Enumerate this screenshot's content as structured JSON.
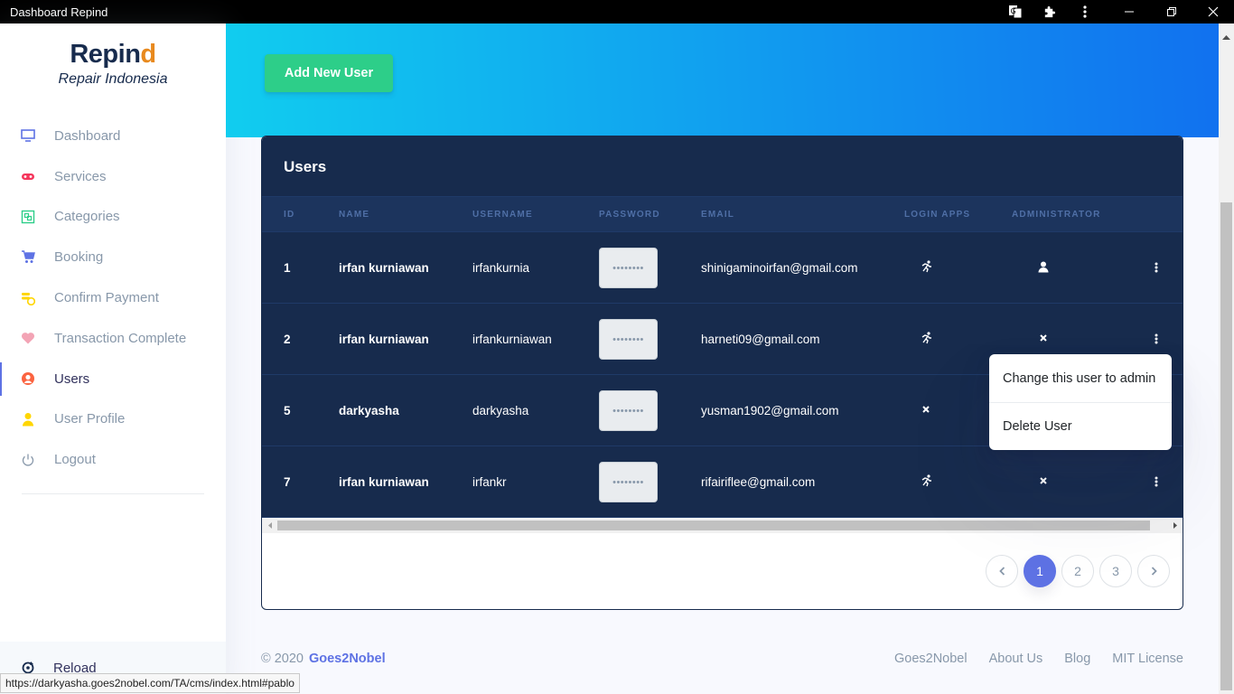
{
  "window": {
    "title": "Dashboard Repind"
  },
  "brand": {
    "name_main": "Repin",
    "name_accent": "d",
    "subtitle": "Repair Indonesia"
  },
  "sidebar": {
    "items": [
      {
        "label": "Dashboard",
        "icon": "monitor-icon",
        "color": "#5e72e4"
      },
      {
        "label": "Services",
        "icon": "gamepad-icon",
        "color": "#f5365c"
      },
      {
        "label": "Categories",
        "icon": "ungroup-icon",
        "color": "#2dce89"
      },
      {
        "label": "Booking",
        "icon": "cart-icon",
        "color": "#5e72e4"
      },
      {
        "label": "Confirm Payment",
        "icon": "coins-icon",
        "color": "#ffd600"
      },
      {
        "label": "Transaction Complete",
        "icon": "heart-icon",
        "color": "#f3a4b5"
      },
      {
        "label": "Users",
        "icon": "user-circle-icon",
        "color": "#fb6340"
      },
      {
        "label": "User Profile",
        "icon": "single-user-icon",
        "color": "#ffd600"
      },
      {
        "label": "Logout",
        "icon": "power-icon",
        "color": "#8898aa"
      }
    ],
    "reload_label": "Reload"
  },
  "header": {
    "add_button": "Add New User"
  },
  "table": {
    "title": "Users",
    "columns": [
      "ID",
      "NAME",
      "USERNAME",
      "PASSWORD",
      "EMAIL",
      "LOGIN APPS",
      "ADMINISTRATOR"
    ],
    "rows": [
      {
        "id": "1",
        "name": "irfan kurniawan",
        "username": "irfankurnia",
        "password": "••••••••",
        "email": "shinigaminoirfan@gmail.com",
        "login_apps": "running-icon",
        "admin": "user-icon"
      },
      {
        "id": "2",
        "name": "irfan kurniawan",
        "username": "irfankurniawan",
        "password": "••••••••",
        "email": "harneti09@gmail.com",
        "login_apps": "running-icon",
        "admin": "x-icon"
      },
      {
        "id": "5",
        "name": "darkyasha",
        "username": "darkyasha",
        "password": "••••••••",
        "email": "yusman1902@gmail.com",
        "login_apps": "x-icon",
        "admin": ""
      },
      {
        "id": "7",
        "name": "irfan kurniawan",
        "username": "irfankr",
        "password": "••••••••",
        "email": "rifairiflee@gmail.com",
        "login_apps": "running-icon",
        "admin": "x-icon"
      }
    ]
  },
  "dropdown": {
    "items": [
      "Change this user to admin",
      "Delete User"
    ]
  },
  "pagination": {
    "pages": [
      "1",
      "2",
      "3"
    ],
    "active": "1"
  },
  "footer": {
    "copyright": "© 2020",
    "brand_link": "Goes2Nobel",
    "links": [
      "Goes2Nobel",
      "About Us",
      "Blog",
      "MIT License"
    ]
  },
  "status_url": "https://darkyasha.goes2nobel.com/TA/cms/index.html#pablo",
  "colors": {
    "primary": "#5e72e4",
    "success": "#2dce89",
    "dark": "#172b4d"
  }
}
